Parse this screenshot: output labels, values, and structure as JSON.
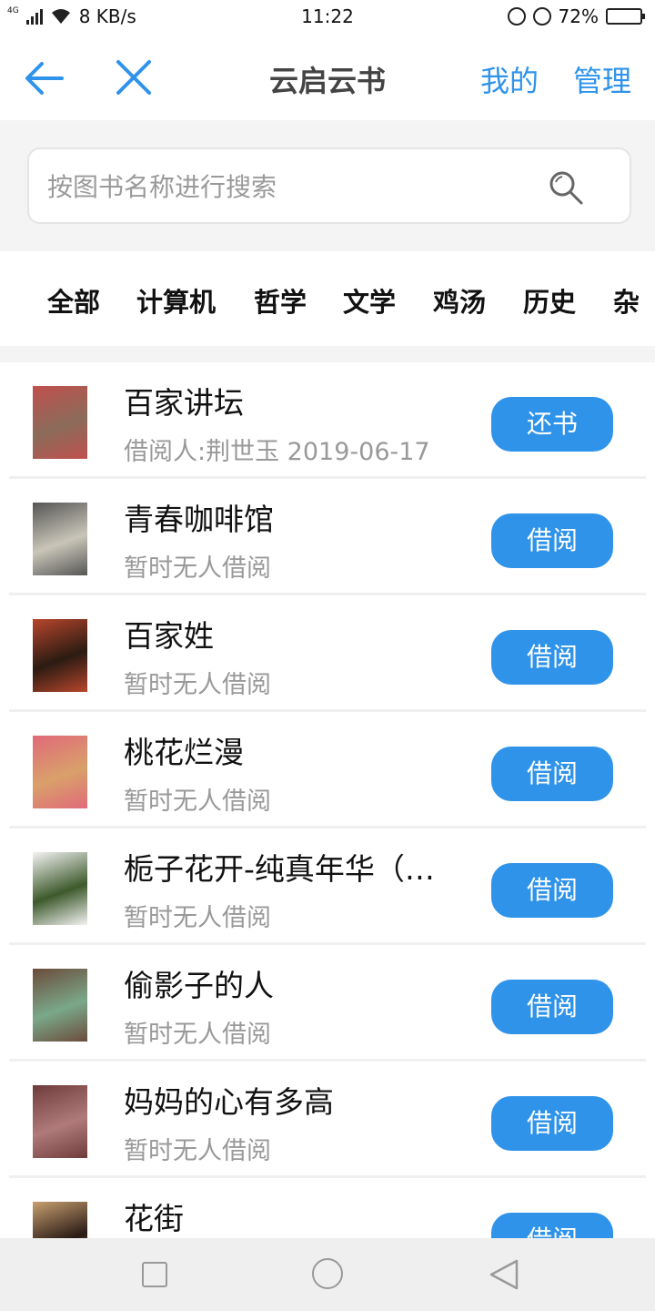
{
  "status_bar": {
    "network": "4G",
    "speed": "8 KB/s",
    "time": "11:22",
    "battery_pct": "72%",
    "battery_level": 0.72
  },
  "navbar": {
    "title": "云启云书",
    "mine_label": "我的",
    "manage_label": "管理"
  },
  "search": {
    "placeholder": "按图书名称进行搜索"
  },
  "categories": [
    "全部",
    "计算机",
    "哲学",
    "文学",
    "鸡汤",
    "历史",
    "杂"
  ],
  "books": [
    {
      "title": "百家讲坛",
      "status": "借阅人:荆世玉  2019-06-17",
      "action": "还书",
      "cover_color": "#8b6b5a",
      "cover_accent": "#c0504d"
    },
    {
      "title": "青春咖啡馆",
      "status": "暂时无人借阅",
      "action": "借阅",
      "cover_color": "#c9c6b8",
      "cover_accent": "#555"
    },
    {
      "title": "百家姓",
      "status": "暂时无人借阅",
      "action": "借阅",
      "cover_color": "#2b1b12",
      "cover_accent": "#b8462c"
    },
    {
      "title": "桃花烂漫",
      "status": "暂时无人借阅",
      "action": "借阅",
      "cover_color": "#d9a06a",
      "cover_accent": "#e06a7a"
    },
    {
      "title": "栀子花开-纯真年华（…",
      "status": "暂时无人借阅",
      "action": "借阅",
      "cover_color": "#3e5a2c",
      "cover_accent": "#f3f3f3"
    },
    {
      "title": "偷影子的人",
      "status": "暂时无人借阅",
      "action": "借阅",
      "cover_color": "#7aa88a",
      "cover_accent": "#6b4b3a"
    },
    {
      "title": "妈妈的心有多高",
      "status": "暂时无人借阅",
      "action": "借阅",
      "cover_color": "#b07a7a",
      "cover_accent": "#6e3b3b"
    },
    {
      "title": "花街",
      "status": "",
      "action": "借阅",
      "cover_color": "#2a1b16",
      "cover_accent": "#c8a070"
    }
  ]
}
